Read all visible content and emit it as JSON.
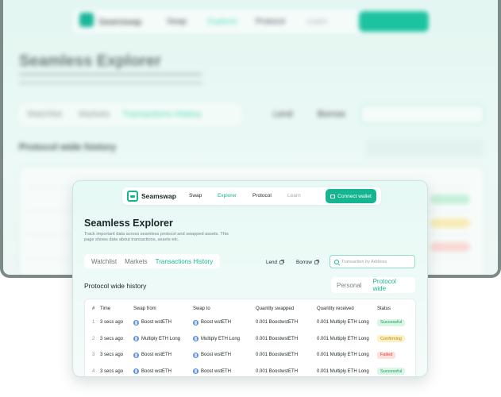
{
  "app": {
    "brand": "Seamswap",
    "nav": [
      {
        "label": "Swap",
        "state": "default"
      },
      {
        "label": "Explorer",
        "state": "active"
      },
      {
        "label": "Protocol",
        "state": "default"
      },
      {
        "label": "Learn",
        "state": "muted"
      }
    ],
    "connect_label": "Connect wallet"
  },
  "page": {
    "title": "Seamless Explorer",
    "description": "Track important data across seamless protocol and swapped assets. This page shows data about transactions, assets etc."
  },
  "tabs": [
    {
      "label": "Watchlist",
      "active": false
    },
    {
      "label": "Markets",
      "active": false
    },
    {
      "label": "Transactions History",
      "active": true
    }
  ],
  "links": {
    "lend": "Lend",
    "borrow": "Borrow"
  },
  "search": {
    "placeholder": "Transaction by Address",
    "value": ""
  },
  "section": {
    "title": "Protocol wide history",
    "toggle": [
      {
        "label": "Personal",
        "active": false
      },
      {
        "label": "Protocol wide",
        "active": true
      }
    ]
  },
  "table": {
    "headers": [
      "#",
      "Time",
      "Swap from",
      "Swap to",
      "Quantity swapped",
      "Quantity received",
      "Status"
    ],
    "rows": [
      {
        "idx": "1",
        "time": "3 secs ago",
        "from": "Boost wstETH",
        "to": "Boost wstETH",
        "qty_swapped": "0.001 BoostwstETH",
        "qty_received": "0.001 Multiply ETH Long",
        "status": "Successful",
        "status_kind": "success"
      },
      {
        "idx": "2",
        "time": "3 secs ago",
        "from": "Multiply ETH Long",
        "to": "Multiply ETH Long",
        "qty_swapped": "0.001 BoostwstETH",
        "qty_received": "0.001 Multiply ETH Long",
        "status": "Confirming",
        "status_kind": "pending"
      },
      {
        "idx": "3",
        "time": "3 secs ago",
        "from": "Boost wstETH",
        "to": "Boost wstETH",
        "qty_swapped": "0.001 BoostwstETH",
        "qty_received": "0.001 Multiply ETH Long",
        "status": "Failed",
        "status_kind": "failed"
      },
      {
        "idx": "4",
        "time": "3 secs ago",
        "from": "Boost wstETH",
        "to": "Boost wstETH",
        "qty_swapped": "0.001 BoostwstETH",
        "qty_received": "0.001 Multiply ETH Long",
        "status": "Successful",
        "status_kind": "success"
      }
    ]
  },
  "colors": {
    "accent": "#16b592",
    "success_bg": "#d9f6e6",
    "success_fg": "#1c9b5a",
    "pending_bg": "#fdf1c6",
    "pending_fg": "#b98a07",
    "failed_bg": "#fde0dc",
    "failed_fg": "#d6453a"
  },
  "icons": {
    "logo": "seamswap-logo-icon",
    "wallet": "wallet-icon",
    "external": "external-link-icon",
    "search": "search-icon",
    "token": "token-icon"
  }
}
